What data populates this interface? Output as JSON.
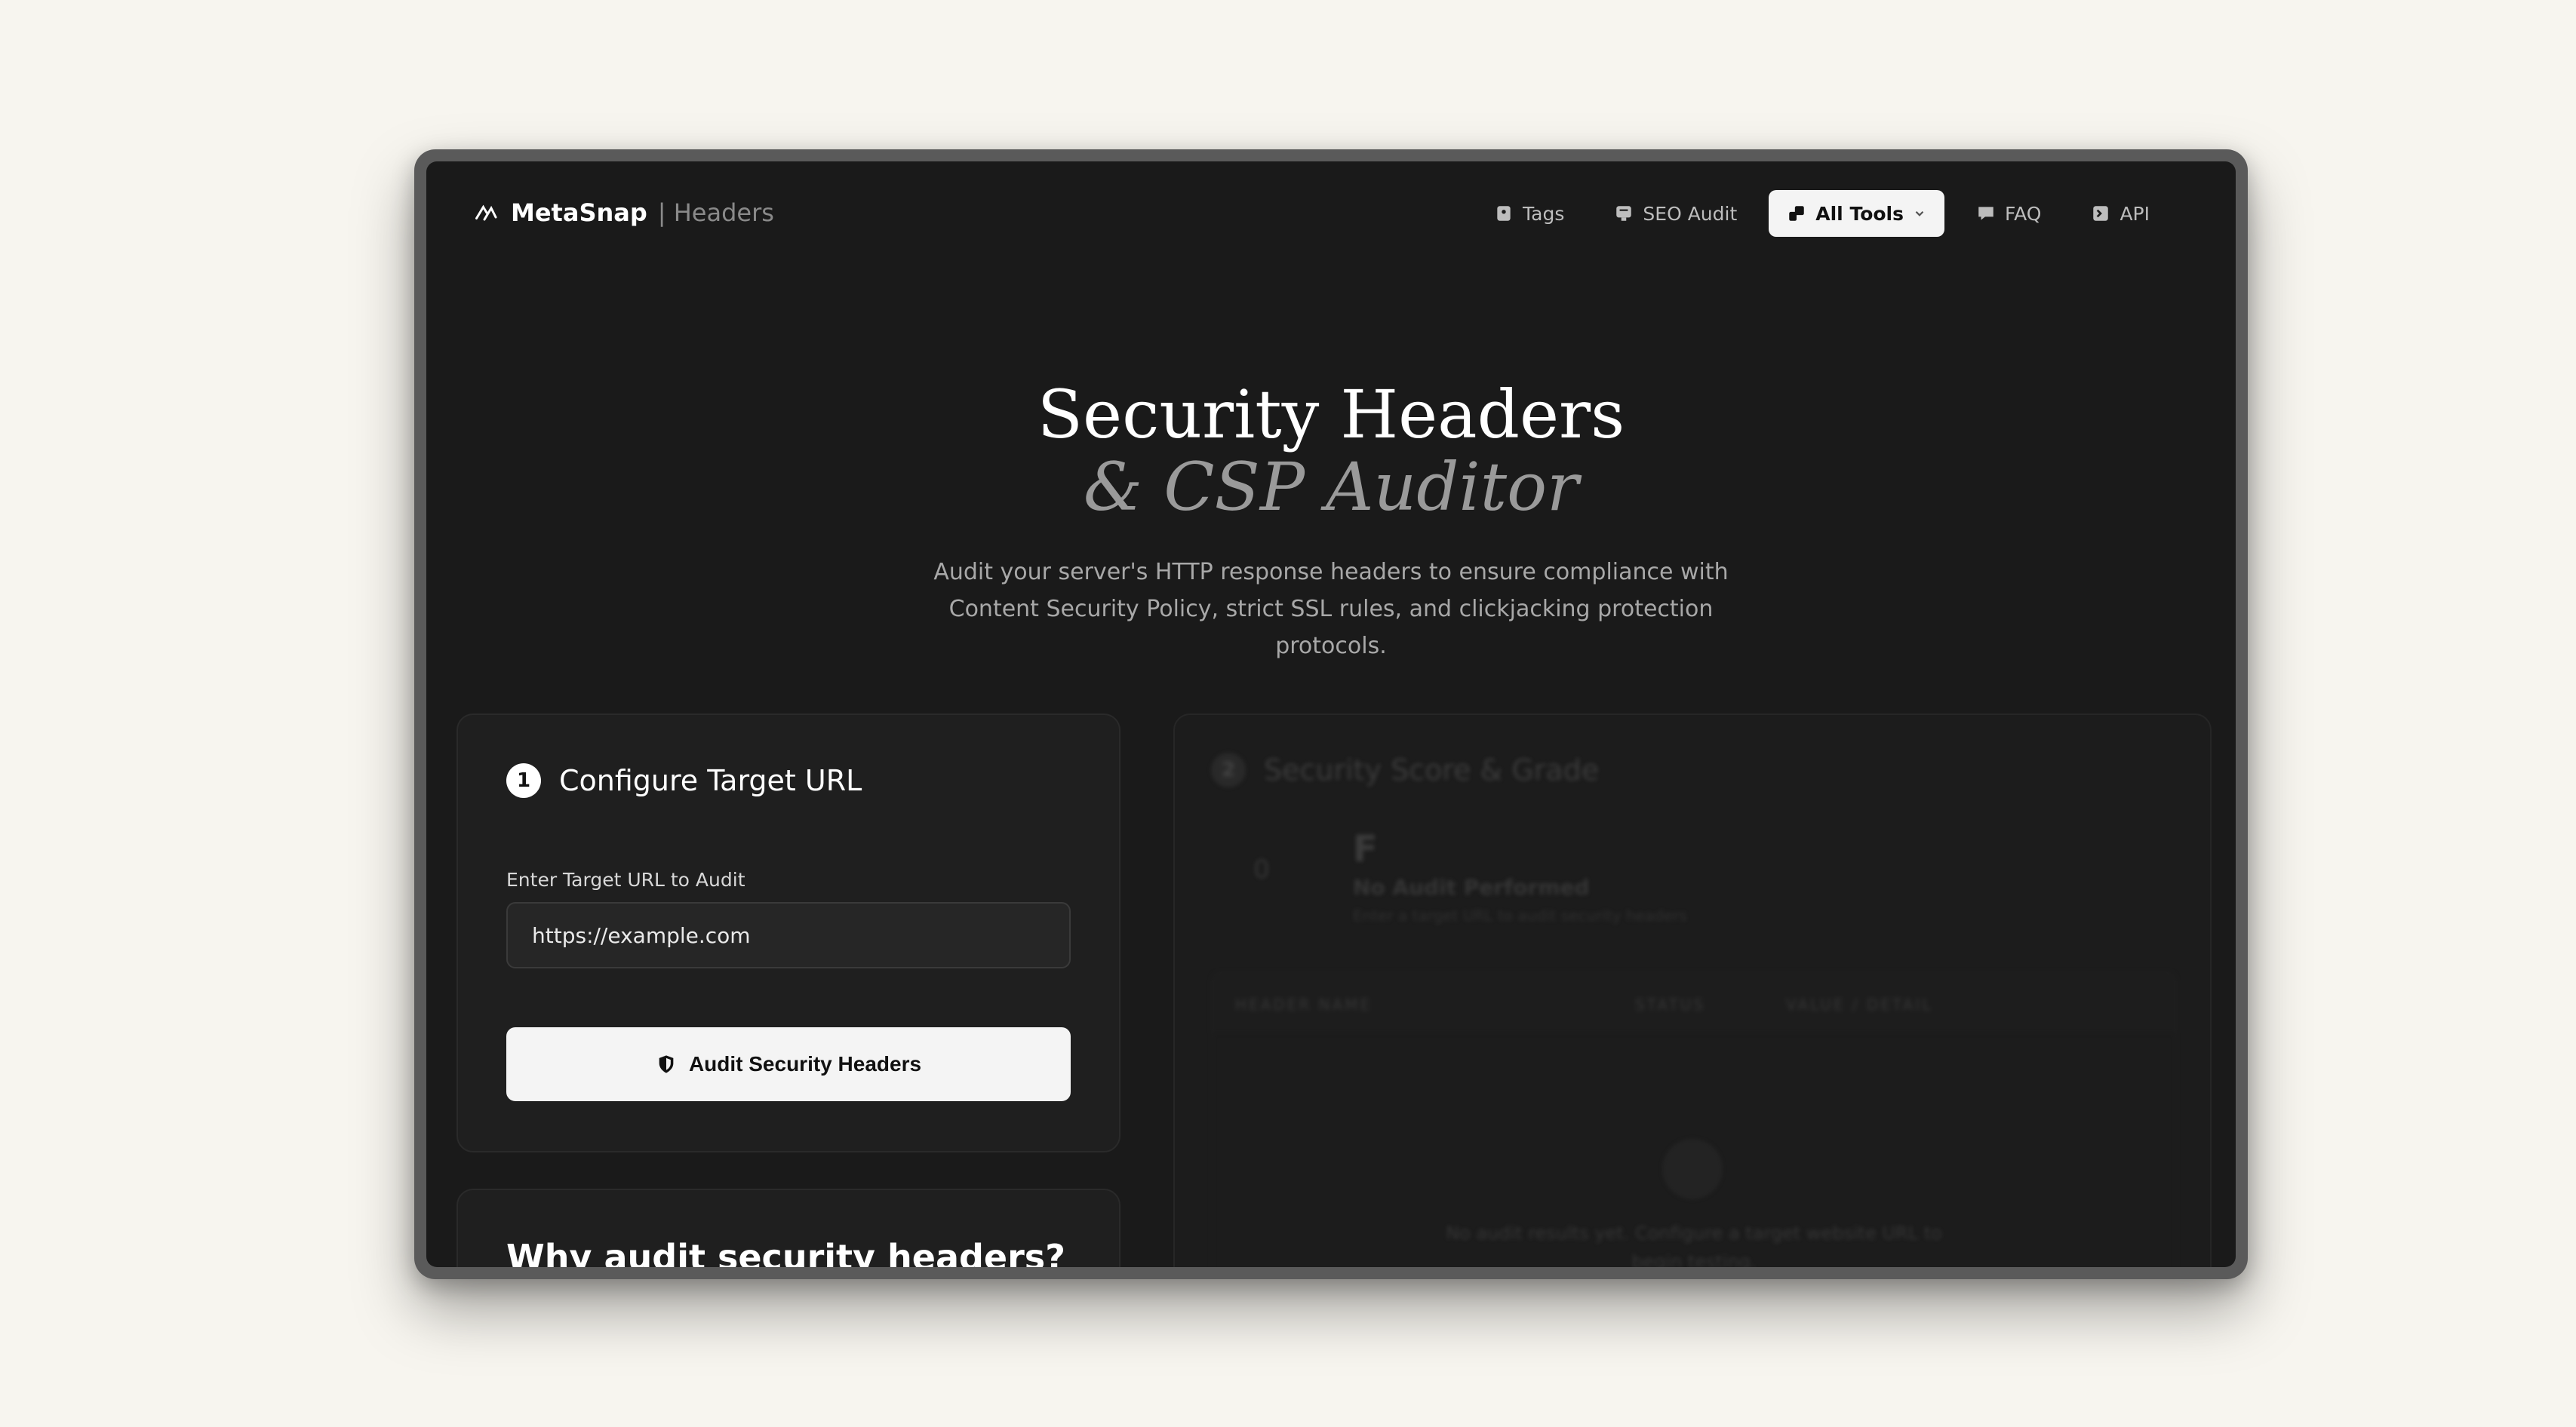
{
  "brand": {
    "name": "MetaSnap",
    "section": "| Headers"
  },
  "nav": {
    "items": [
      {
        "label": "Tags",
        "icon": "tag-icon"
      },
      {
        "label": "SEO Audit",
        "icon": "seo-audit-icon"
      },
      {
        "label": "All Tools",
        "icon": "tools-icon",
        "active": true
      },
      {
        "label": "FAQ",
        "icon": "faq-icon"
      },
      {
        "label": "API",
        "icon": "terminal-icon"
      }
    ]
  },
  "hero": {
    "title": "Security Headers",
    "subtitle": "& CSP Auditor",
    "description": "Audit your server's HTTP response headers to ensure compliance with Content Security Policy, strict SSL rules, and clickjacking protection protocols."
  },
  "config": {
    "step": "1",
    "title": "Configure Target URL",
    "field_label": "Enter Target URL to Audit",
    "url_value": "https://example.com",
    "button_label": "Audit Security Headers"
  },
  "why": {
    "title": "Why audit security headers?"
  },
  "score": {
    "step": "2",
    "title": "Security Score & Grade",
    "gauge_value": "0",
    "grade": "F",
    "grade_label": "No Audit Performed",
    "grade_note": "Enter a target URL to audit security headers",
    "columns": [
      "HEADER NAME",
      "STATUS",
      "VALUE / DETAIL"
    ],
    "empty_text": "No audit results yet. Configure a target website URL to begin testing."
  },
  "colors": {
    "background": "#f7f5ef",
    "screen": "#1a1a1a",
    "accent": "#f4f4f4"
  }
}
